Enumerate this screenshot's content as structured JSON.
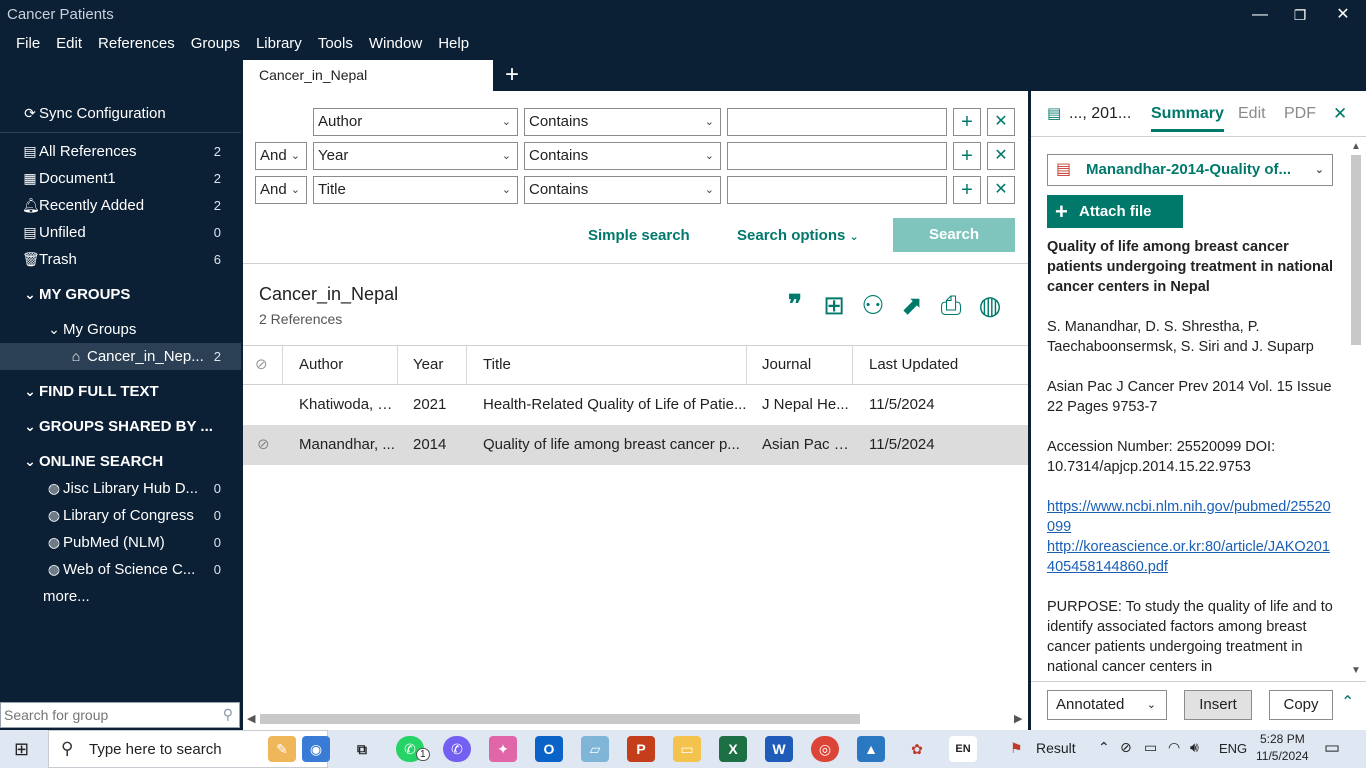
{
  "window": {
    "title": "Cancer Patients",
    "controls": {
      "minimize": "—",
      "restore": "❐",
      "close": "✕"
    }
  },
  "menu": [
    "File",
    "Edit",
    "References",
    "Groups",
    "Library",
    "Tools",
    "Window",
    "Help"
  ],
  "tabs": {
    "active": "Cancer_in_Nepal",
    "add": "+"
  },
  "sidebar": {
    "sync": "Sync Configuration",
    "items": [
      {
        "label": "All References",
        "count": "2",
        "icon": "clipboard-icon"
      },
      {
        "label": "Document1",
        "count": "2",
        "icon": "word-doc-icon"
      },
      {
        "label": "Recently Added",
        "count": "2",
        "icon": "bell-icon"
      },
      {
        "label": "Unfiled",
        "count": "0",
        "icon": "clipboard-icon"
      },
      {
        "label": "Trash",
        "count": "6",
        "icon": "trash-icon"
      }
    ],
    "my_groups_header": "MY GROUPS",
    "my_groups_sub": "My Groups",
    "selected_group": {
      "label": "Cancer_in_Nep...",
      "count": "2"
    },
    "find_full_text": "FIND FULL TEXT",
    "groups_shared": "GROUPS SHARED BY ...",
    "online_search": "ONLINE SEARCH",
    "online_items": [
      {
        "label": "Jisc Library Hub D...",
        "count": "0"
      },
      {
        "label": "Library of Congress",
        "count": "0"
      },
      {
        "label": "PubMed (NLM)",
        "count": "0"
      },
      {
        "label": "Web of Science C...",
        "count": "0"
      }
    ],
    "more": "more...",
    "search_placeholder": "Search for group"
  },
  "search": {
    "rows": [
      {
        "bool": "",
        "field": "Author",
        "op": "Contains",
        "value": ""
      },
      {
        "bool": "And",
        "field": "Year",
        "op": "Contains",
        "value": ""
      },
      {
        "bool": "And",
        "field": "Title",
        "op": "Contains",
        "value": ""
      }
    ],
    "simple": "Simple search",
    "options": "Search options",
    "button": "Search"
  },
  "group": {
    "title": "Cancer_in_Nepal",
    "count_text": "2 References"
  },
  "table": {
    "headers": [
      "Author",
      "Year",
      "Title",
      "Journal",
      "Last Updated"
    ],
    "rows": [
      {
        "author": "Khatiwoda, S...",
        "year": "2021",
        "title": "Health-Related Quality of Life of Patie...",
        "journal": "J Nepal He...",
        "updated": "11/5/2024"
      },
      {
        "author": "Manandhar, ...",
        "year": "2014",
        "title": "Quality of life among breast cancer p...",
        "journal": "Asian Pac J ...",
        "updated": "11/5/2024"
      }
    ]
  },
  "right": {
    "ref_short": "..., 201...",
    "tabs": [
      "Summary",
      "Edit",
      "PDF"
    ],
    "file": "Manandhar-2014-Quality of...",
    "attach": "Attach file",
    "title": "Quality of life among breast cancer patients undergoing treatment in national cancer centers in Nepal",
    "authors": "S. Manandhar, D. S. Shrestha, P. Taechaboonsermsk, S. Siri and J. Suparp",
    "source": "Asian Pac J Cancer Prev 2014 Vol. 15 Issue 22 Pages 9753-7",
    "accession": "Accession Number: 25520099 DOI: 10.7314/apjcp.2014.15.22.9753",
    "url1": "https://www.ncbi.nlm.nih.gov/pubmed/25520099",
    "url2": "http://koreascience.or.kr:80/article/JAKO201405458144860.pdf",
    "abstract": "PURPOSE: To study the quality of life and to identify associated factors among breast cancer patients undergoing treatment in national cancer centers in",
    "style": "Annotated",
    "insert": "Insert",
    "copy": "Copy"
  },
  "taskbar": {
    "search": "Type here to search",
    "result": "Result",
    "lang": "ENG",
    "time": "5:28 PM",
    "date": "11/5/2024",
    "badge": "1",
    "input_lang": "EN"
  },
  "colors": {
    "accent": "#00796b",
    "sidebar_bg": "#0b1f35"
  }
}
